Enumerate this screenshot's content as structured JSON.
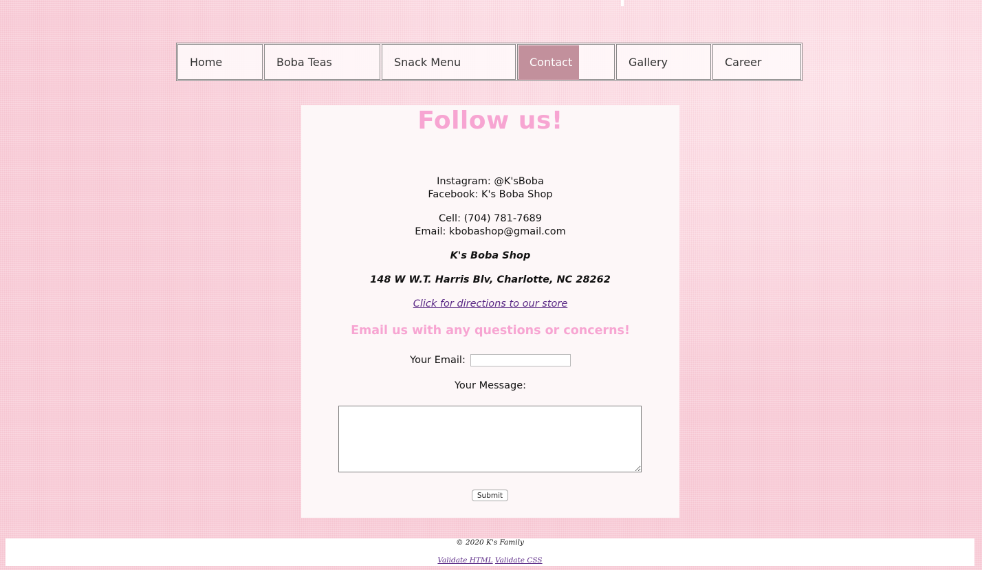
{
  "nav": {
    "items": [
      {
        "label": "Home"
      },
      {
        "label": "Boba Teas"
      },
      {
        "label": "Snack Menu"
      },
      {
        "label": "Contact"
      },
      {
        "label": "Gallery"
      },
      {
        "label": "Career"
      }
    ],
    "active": "Contact"
  },
  "contact": {
    "title": "Follow us!",
    "instagram": "Instagram: @K'sBoba",
    "facebook": "Facebook: K's Boba Shop",
    "cell": "Cell: (704) 781-7689",
    "email": "Email: kbobashop@gmail.com",
    "shop_name": "K's Boba Shop",
    "address": "148 W W.T. Harris Blv, Charlotte, NC 28262",
    "directions_link": "Click for directions to our store"
  },
  "form": {
    "heading": "Email us with any questions or concerns!",
    "email_label": "Your Email:",
    "email_value": "",
    "message_label": "Your Message:",
    "message_value": "",
    "submit_label": "Submit"
  },
  "footer": {
    "copyright": "© 2020 K's Family",
    "validate_html": "Validate HTML",
    "validate_css": "Validate CSS"
  },
  "colors": {
    "accent_pink": "#f7a5d2",
    "nav_active": "#c2909c",
    "link": "#5b2a86"
  }
}
